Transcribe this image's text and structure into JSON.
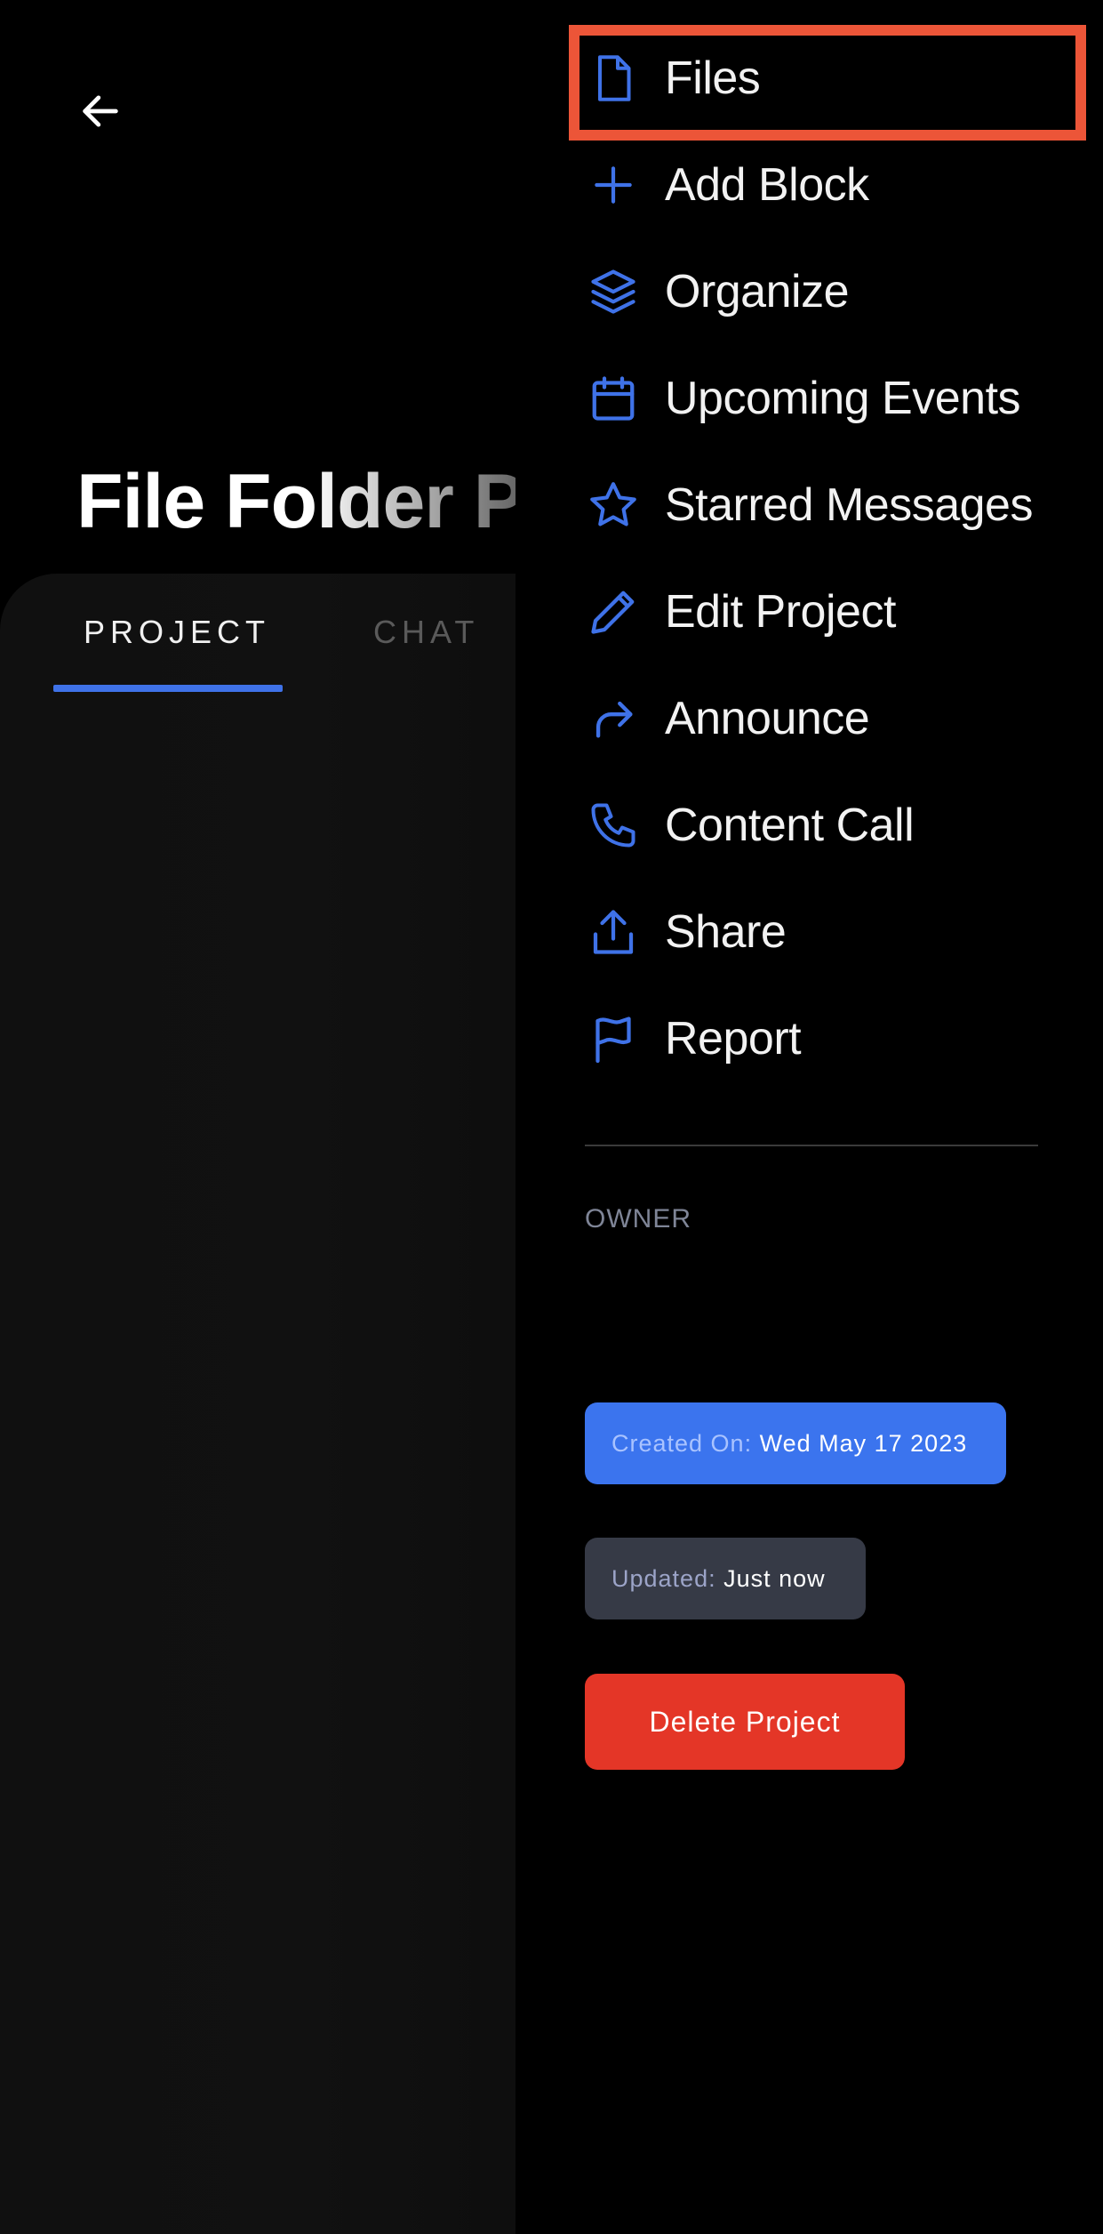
{
  "colors": {
    "accent": "#3f72e8",
    "highlight": "#ec5538",
    "danger": "#e43627",
    "created_chip": "#3b74ee",
    "updated_chip": "#363a46"
  },
  "header": {
    "back_icon": "arrow-left-icon",
    "title": "File Folder P"
  },
  "tabs": [
    {
      "label": "PROJECT",
      "active": true
    },
    {
      "label": "CHAT",
      "active": false
    }
  ],
  "menu": [
    {
      "label": "Files",
      "icon": "file-icon",
      "highlighted": true
    },
    {
      "label": "Add Block",
      "icon": "plus-icon"
    },
    {
      "label": "Organize",
      "icon": "layers-icon"
    },
    {
      "label": "Upcoming Events",
      "icon": "calendar-icon"
    },
    {
      "label": "Starred Messages",
      "icon": "star-icon"
    },
    {
      "label": "Edit Project",
      "icon": "pencil-icon"
    },
    {
      "label": "Announce",
      "icon": "forward-arrow-icon"
    },
    {
      "label": "Content Call",
      "icon": "phone-icon"
    },
    {
      "label": "Share",
      "icon": "share-icon"
    },
    {
      "label": "Report",
      "icon": "flag-icon"
    }
  ],
  "owner_label": "OWNER",
  "created": {
    "key": "Created On:",
    "value": "Wed May 17 2023"
  },
  "updated": {
    "key": "Updated:",
    "value": "Just now"
  },
  "delete_label": "Delete Project"
}
